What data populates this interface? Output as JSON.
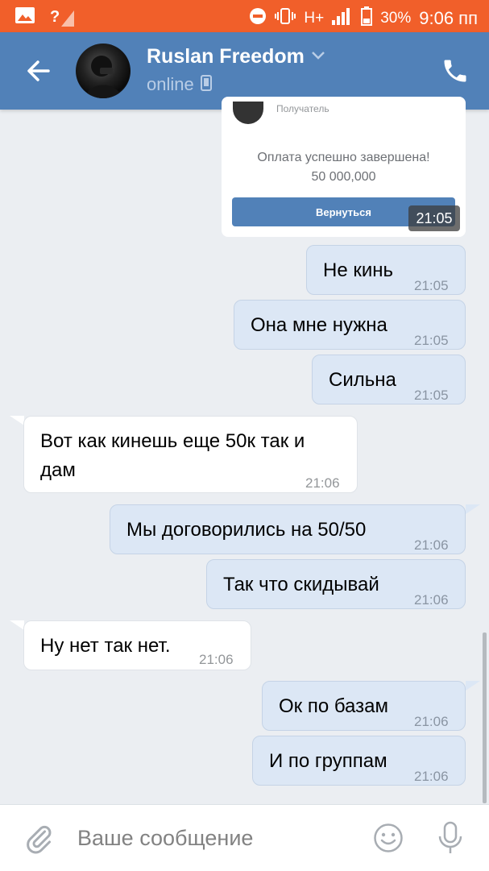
{
  "status_bar": {
    "signal_label": "?",
    "network": "H+",
    "battery": "30%",
    "time": "9:06 пп"
  },
  "header": {
    "contact_name": "Ruslan Freedom",
    "status": "online"
  },
  "payment_card": {
    "recipient_label": "Получатель",
    "message": "Оплата успешно завершена!",
    "amount": "50 000,000",
    "button_label": "Вернуться",
    "time": "21:05"
  },
  "messages": [
    {
      "dir": "out",
      "text": "Не кинь",
      "time": "21:05"
    },
    {
      "dir": "out",
      "text": "Она мне нужна",
      "time": "21:05"
    },
    {
      "dir": "out",
      "text": "Сильна",
      "time": "21:05"
    },
    {
      "dir": "in",
      "text_line1": "Вот как кинешь еще 50к так и",
      "text_line2": "дам",
      "time": "21:06"
    },
    {
      "dir": "out",
      "text": "Мы договорились на 50/50",
      "time": "21:06"
    },
    {
      "dir": "out",
      "text": "Так что скидывай",
      "time": "21:06"
    },
    {
      "dir": "in",
      "text": "Ну нет так нет.",
      "time": "21:06"
    },
    {
      "dir": "out",
      "text": "Ок по базам",
      "time": "21:06"
    },
    {
      "dir": "out",
      "text": "И по группам",
      "time": "21:06"
    }
  ],
  "composer": {
    "placeholder": "Ваше сообщение"
  },
  "colors": {
    "status_bar": "#f15f2a",
    "header": "#5181b8",
    "outgoing_bubble": "#dce7f5",
    "background": "#ebeef2"
  }
}
